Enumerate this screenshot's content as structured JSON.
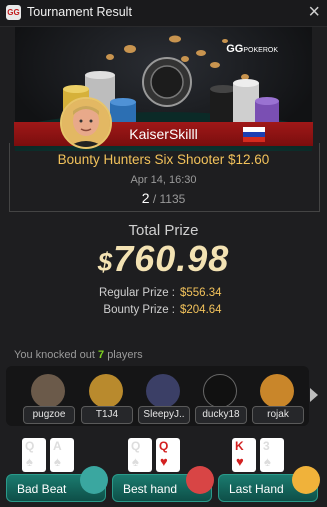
{
  "window": {
    "title": "Tournament Result",
    "logo_text": "GG",
    "close_glyph": "×"
  },
  "banner": {
    "brand": "GG",
    "brand_sub": "POKEROK"
  },
  "player": {
    "name": "KaiserSkilll",
    "flag_country": "Russia",
    "flag_colors": [
      "#ffffff",
      "#1c3fb3",
      "#d52b1e"
    ]
  },
  "tournament": {
    "name": "Bounty Hunters Six Shooter $12.60",
    "datetime": "Apr 14, 16:30",
    "place": "2",
    "field_sep": " / ",
    "field_size": "1135"
  },
  "prize": {
    "total_label": "Total Prize",
    "currency": "$",
    "total_amount": "760.98",
    "regular_label": "Regular Prize :",
    "regular_value": "$556.34",
    "bounty_label": "Bounty Prize :",
    "bounty_value": "$204.64"
  },
  "knockouts": {
    "prefix": "You knocked out",
    "count": "7",
    "suffix": "players",
    "players": [
      {
        "name": "pugzoe",
        "avatar_icon": "pug-avatar-icon",
        "color": "#6b5a4a"
      },
      {
        "name": "T1J4",
        "avatar_icon": "gold-buddha-avatar-icon",
        "color": "#b98a2d"
      },
      {
        "name": "SleepyJ..",
        "avatar_icon": "man-portrait-avatar-icon",
        "color": "#3b3f66"
      },
      {
        "name": "ducky18",
        "avatar_icon": "jack-daniels-avatar-icon",
        "color": "#111111"
      },
      {
        "name": "rojak",
        "avatar_icon": "cartoon-avatar-icon",
        "color": "#c9862a"
      }
    ]
  },
  "buttons": [
    {
      "label": "Bad Beat",
      "cards": [
        {
          "rank": "Q",
          "suit": "♠",
          "color": "#111"
        },
        {
          "rank": "A",
          "suit": "♠",
          "color": "#111"
        }
      ],
      "emoji_color": "#3aa7a0"
    },
    {
      "label": "Best hand",
      "cards": [
        {
          "rank": "Q",
          "suit": "♠",
          "color": "#111"
        },
        {
          "rank": "Q",
          "suit": "♥",
          "color": "#d32020"
        }
      ],
      "emoji_color": "#d84545"
    },
    {
      "label": "Last Hand",
      "cards": [
        {
          "rank": "K",
          "suit": "♥",
          "color": "#d32020"
        },
        {
          "rank": "3",
          "suit": "♠",
          "color": "#111"
        }
      ],
      "emoji_color": "#f0b23a"
    }
  ],
  "colors": {
    "accent_gold": "#f2c25b",
    "ribbon_red": "#a01818",
    "button_teal": "#1b7b6f",
    "knock_count_green": "#7ed321"
  }
}
